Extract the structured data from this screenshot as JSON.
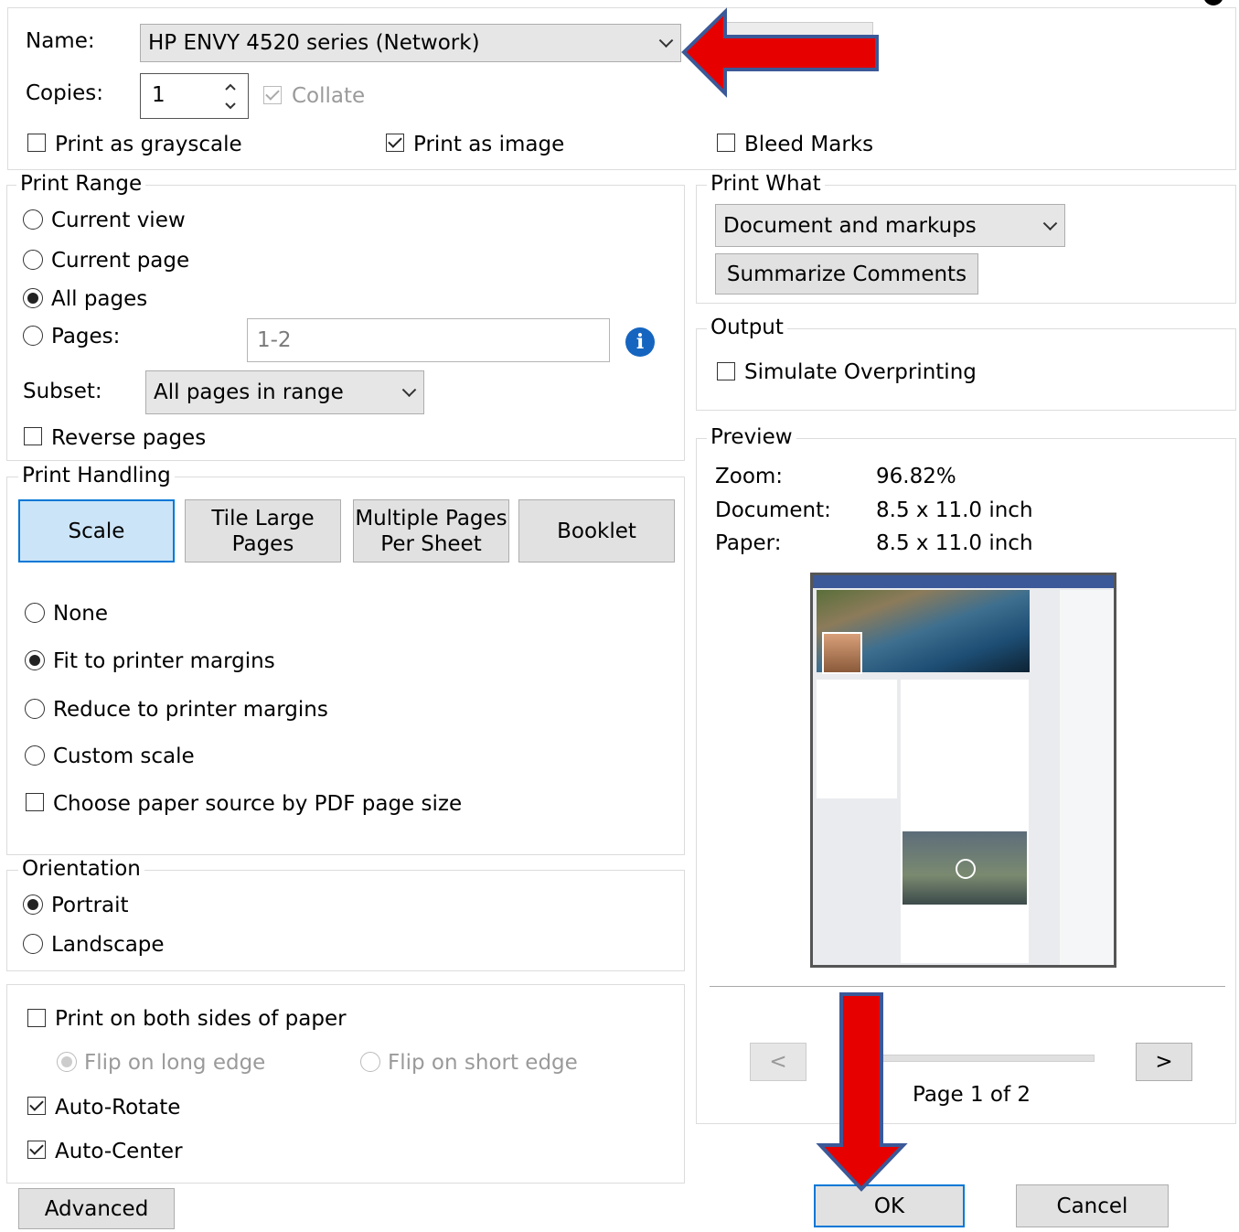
{
  "printer": {
    "name_label": "Name:",
    "name_value": "HP ENVY 4520 series (Network)",
    "copies_label": "Copies:",
    "copies_value": "1",
    "collate_label": "Collate",
    "collate_checked": true,
    "grayscale_label": "Print as grayscale",
    "print_as_image_label": "Print as image",
    "bleed_marks_label": "Bleed Marks"
  },
  "print_range": {
    "legend": "Print Range",
    "current_view": "Current view",
    "current_page": "Current page",
    "all_pages": "All pages",
    "pages_label": "Pages:",
    "pages_placeholder": "1-2",
    "subset_label": "Subset:",
    "subset_value": "All pages in range",
    "reverse_label": "Reverse pages",
    "info_glyph": "i"
  },
  "print_handling": {
    "legend": "Print Handling",
    "tabs": [
      "Scale",
      "Tile Large Pages",
      "Multiple Pages Per Sheet",
      "Booklet"
    ],
    "tab_lines": [
      [
        "Scale"
      ],
      [
        "Tile Large",
        "Pages"
      ],
      [
        "Multiple Pages",
        "Per Sheet"
      ],
      [
        "Booklet"
      ]
    ],
    "none": "None",
    "fit": "Fit to printer margins",
    "reduce": "Reduce to printer margins",
    "custom": "Custom scale",
    "paper_source": "Choose paper source by PDF page size"
  },
  "orientation": {
    "legend": "Orientation",
    "portrait": "Portrait",
    "landscape": "Landscape"
  },
  "duplex": {
    "both_sides": "Print on both sides of paper",
    "flip_long": "Flip on long edge",
    "flip_short": "Flip on short edge",
    "auto_rotate": "Auto-Rotate",
    "auto_center": "Auto-Center"
  },
  "print_what": {
    "legend": "Print What",
    "value": "Document and markups",
    "summarize": "Summarize Comments"
  },
  "output": {
    "legend": "Output",
    "simulate": "Simulate Overprinting"
  },
  "preview": {
    "legend": "Preview",
    "zoom_label": "Zoom:",
    "zoom_value": "96.82%",
    "document_label": "Document:",
    "document_value": "8.5 x 11.0 inch",
    "paper_label": "Paper:",
    "paper_value": "8.5 x 11.0 inch",
    "prev": "<",
    "next": ">",
    "page_status": "Page 1 of 2"
  },
  "buttons": {
    "advanced": "Advanced",
    "ok": "OK",
    "cancel": "Cancel"
  },
  "colors": {
    "accent": "#0078d7",
    "annotation_arrow": "#e60000",
    "annotation_arrow_border": "#3b5998"
  }
}
